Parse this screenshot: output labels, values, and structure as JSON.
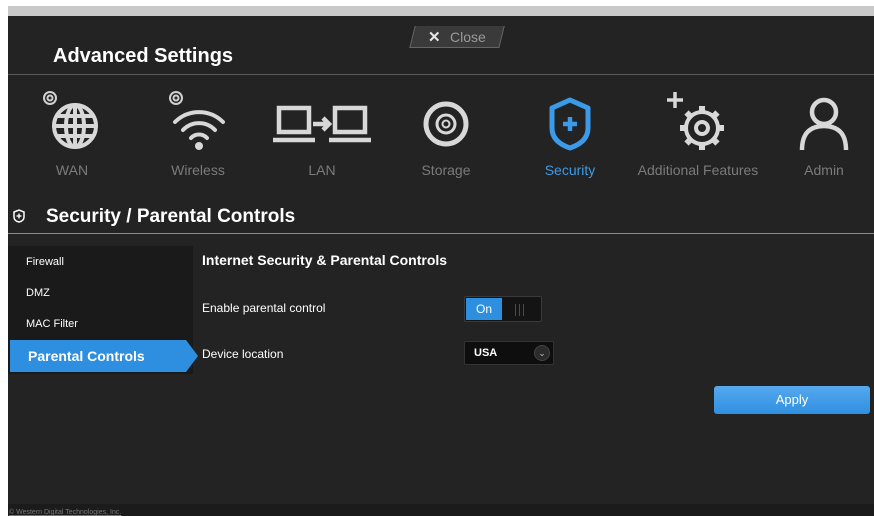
{
  "header": {
    "title": "Advanced Settings",
    "close_label": "Close"
  },
  "nav": {
    "items": [
      {
        "label": "WAN",
        "icon": "globe-gear-icon"
      },
      {
        "label": "Wireless",
        "icon": "wifi-gear-icon"
      },
      {
        "label": "LAN",
        "icon": "lan-transfer-icon"
      },
      {
        "label": "Storage",
        "icon": "storage-disk-icon"
      },
      {
        "label": "Security",
        "icon": "security-shield-icon",
        "active": true
      },
      {
        "label": "Additional Features",
        "icon": "gear-plus-icon"
      },
      {
        "label": "Admin",
        "icon": "user-icon"
      }
    ]
  },
  "section": {
    "title": "Security / Parental Controls"
  },
  "sidebar": {
    "items": [
      {
        "label": "Firewall"
      },
      {
        "label": "DMZ"
      },
      {
        "label": "MAC Filter"
      },
      {
        "label": "Parental Controls",
        "active": true
      }
    ]
  },
  "content": {
    "title": "Internet Security & Parental Controls",
    "enable_label": "Enable parental control",
    "toggle_state": "On",
    "location_label": "Device location",
    "location_value": "USA",
    "apply_label": "Apply"
  },
  "footer": {
    "text": "© Western Digital Technologies, Inc."
  },
  "colors": {
    "accent": "#2e8fe0",
    "background": "#232323",
    "inactive_text": "#7b7b7b"
  }
}
